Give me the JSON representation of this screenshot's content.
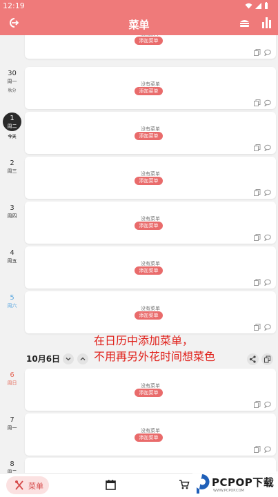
{
  "status_bar": {
    "time": "12:19"
  },
  "app_bar": {
    "title": "菜单"
  },
  "days": [
    {
      "num": "",
      "weekday": "",
      "sub": ""
    },
    {
      "num": "30",
      "weekday": "周一",
      "sub": "秋分"
    },
    {
      "num": "1",
      "weekday": "周二",
      "sub": "今天"
    },
    {
      "num": "2",
      "weekday": "周三",
      "sub": ""
    },
    {
      "num": "3",
      "weekday": "周四",
      "sub": ""
    },
    {
      "num": "4",
      "weekday": "周五",
      "sub": ""
    },
    {
      "num": "5",
      "weekday": "周六",
      "sub": ""
    },
    {
      "num": "6",
      "weekday": "周日",
      "sub": ""
    },
    {
      "num": "7",
      "weekday": "周一",
      "sub": ""
    },
    {
      "num": "8",
      "weekday": "周二",
      "sub": ""
    }
  ],
  "card": {
    "empty_text": "没有菜单",
    "add_button": "添加菜单"
  },
  "caption": {
    "line1": "在日历中添加菜单，",
    "line2": "不用再另外花时间想菜色"
  },
  "week_header": {
    "date": "10月6日"
  },
  "bottom_nav": {
    "menu_label": "菜单"
  },
  "watermark": {
    "main": "PCPOP下载",
    "sub": "WWW.PCPOP.COM"
  },
  "colors": {
    "accent": "#ef7a7a",
    "button": "#e96b6b",
    "saturday": "#5aa7e0",
    "sunday": "#e56a5a"
  }
}
